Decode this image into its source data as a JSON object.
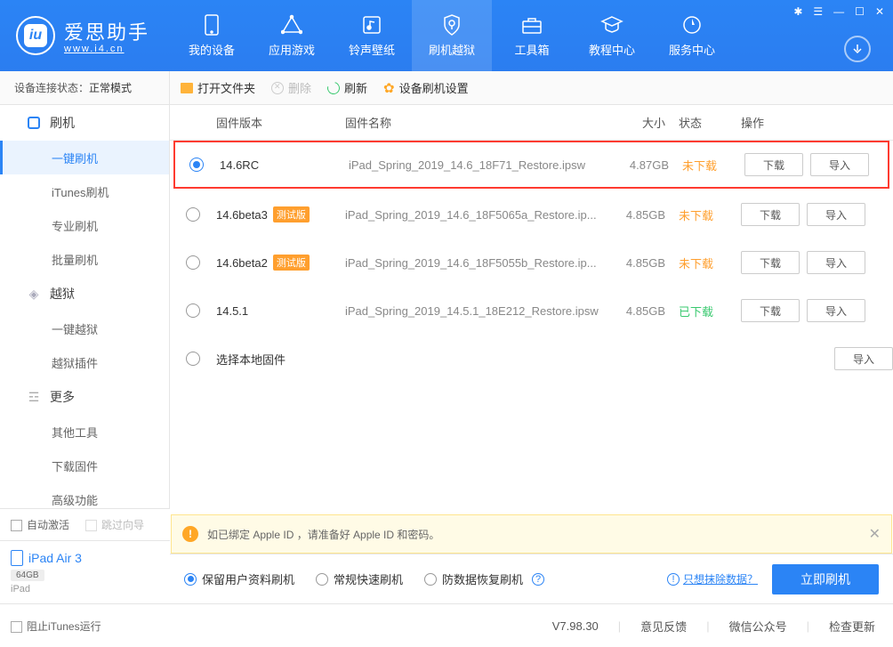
{
  "logo": {
    "title": "爱思助手",
    "subtitle": "www.i4.cn",
    "icon_letter": "iu"
  },
  "nav": [
    {
      "label": "我的设备"
    },
    {
      "label": "应用游戏"
    },
    {
      "label": "铃声壁纸"
    },
    {
      "label": "刷机越狱",
      "active": true
    },
    {
      "label": "工具箱"
    },
    {
      "label": "教程中心"
    },
    {
      "label": "服务中心"
    }
  ],
  "device_status": {
    "label": "设备连接状态：",
    "mode": "正常模式"
  },
  "toolbar": {
    "open_folder": "打开文件夹",
    "delete": "删除",
    "refresh": "刷新",
    "settings": "设备刷机设置"
  },
  "sidebar": {
    "flash": {
      "header": "刷机",
      "items": [
        "一键刷机",
        "iTunes刷机",
        "专业刷机",
        "批量刷机"
      ]
    },
    "jailbreak": {
      "header": "越狱",
      "items": [
        "一键越狱",
        "越狱插件"
      ]
    },
    "more": {
      "header": "更多",
      "items": [
        "其他工具",
        "下载固件",
        "高级功能"
      ]
    }
  },
  "table": {
    "headers": {
      "version": "固件版本",
      "name": "固件名称",
      "size": "大小",
      "status": "状态",
      "action": "操作"
    },
    "rows": [
      {
        "version": "14.6RC",
        "beta": false,
        "name": "iPad_Spring_2019_14.6_18F71_Restore.ipsw",
        "size": "4.87GB",
        "status": "未下载",
        "downloaded": false,
        "selected": true
      },
      {
        "version": "14.6beta3",
        "beta": true,
        "name": "iPad_Spring_2019_14.6_18F5065a_Restore.ip...",
        "size": "4.85GB",
        "status": "未下载",
        "downloaded": false,
        "selected": false
      },
      {
        "version": "14.6beta2",
        "beta": true,
        "name": "iPad_Spring_2019_14.6_18F5055b_Restore.ip...",
        "size": "4.85GB",
        "status": "未下载",
        "downloaded": false,
        "selected": false
      },
      {
        "version": "14.5.1",
        "beta": false,
        "name": "iPad_Spring_2019_14.5.1_18E212_Restore.ipsw",
        "size": "4.85GB",
        "status": "已下载",
        "downloaded": true,
        "selected": false
      }
    ],
    "local_row": "选择本地固件",
    "beta_tag": "测试版",
    "btn_download": "下载",
    "btn_import": "导入"
  },
  "warning": {
    "text": "如已绑定 Apple ID ，请准备好 Apple ID 和密码。"
  },
  "options": {
    "keep_data": "保留用户资料刷机",
    "normal": "常规快速刷机",
    "anti_data": "防数据恢复刷机",
    "erase_link": "只想抹除数据？",
    "flash_btn": "立即刷机"
  },
  "left_bottom": {
    "auto_activate": "自动激活",
    "skip_wizard": "跳过向导",
    "device_name": "iPad Air 3",
    "storage": "64GB",
    "device_type": "iPad"
  },
  "footer": {
    "block_itunes": "阻止iTunes运行",
    "version": "V7.98.30",
    "feedback": "意见反馈",
    "wechat": "微信公众号",
    "check_update": "检查更新"
  }
}
